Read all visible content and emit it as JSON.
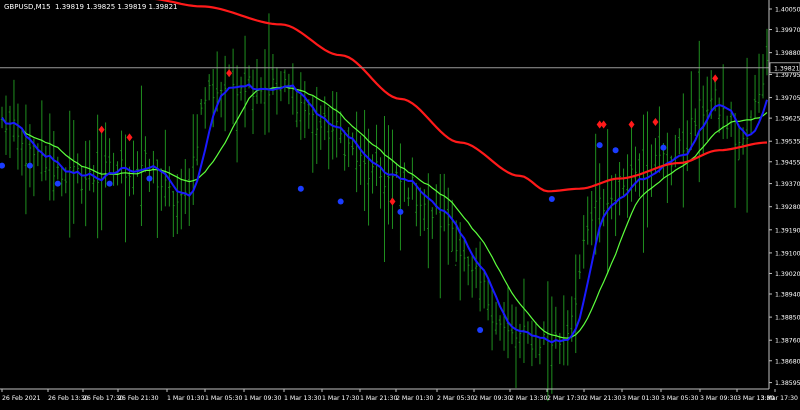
{
  "header": {
    "symbol": "GBPUSD,M15",
    "ohlc": "1.39819 1.39825 1.39819 1.39821"
  },
  "colors": {
    "background": "#000000",
    "axis": "#c0c0c0",
    "text": "#ffffff",
    "candles": "#1f8f1f",
    "ma_fast": "#5cff3c",
    "ma_mid": "#1a1aff",
    "ma_slow": "#ff1a1a",
    "buy_marker": "#1a3cff",
    "sell_marker": "#ff1a1a",
    "bid_line": "#9a9a9a"
  },
  "chart_data": {
    "type": "line",
    "symbol": "GBPUSD",
    "timeframe": "M15",
    "ylim": [
      1.3857,
      1.40085
    ],
    "y_ticks": [
      "1.40050",
      "1.39970",
      "1.39880",
      "1.39795",
      "1.39705",
      "1.39625",
      "1.39535",
      "1.39455",
      "1.39370",
      "1.39280",
      "1.39190",
      "1.39100",
      "1.39020",
      "1.38940",
      "1.38850",
      "1.38760",
      "1.38680",
      "1.38595"
    ],
    "x_ticks": [
      "26 Feb 2021",
      "26 Feb 13:30",
      "26 Feb 17:30",
      "26 Feb 21:30",
      "1 Mar 01:30",
      "1 Mar 05:30",
      "1 Mar 09:30",
      "1 Mar 13:30",
      "1 Mar 17:30",
      "1 Mar 21:30",
      "2 Mar 01:30",
      "2 Mar 05:30",
      "2 Mar 09:30",
      "2 Mar 13:30",
      "2 Mar 17:30",
      "2 Mar 21:30",
      "3 Mar 01:30",
      "3 Mar 05:30",
      "3 Mar 09:30",
      "3 Mar 13:30",
      "3 Mar 17:30"
    ],
    "current_price": "1.39821",
    "bar_count": 193,
    "close_anchors": [
      [
        0,
        1.3961
      ],
      [
        8,
        1.3946
      ],
      [
        20,
        1.3939
      ],
      [
        35,
        1.3944
      ],
      [
        45,
        1.3929
      ],
      [
        52,
        1.3973
      ],
      [
        60,
        1.3977
      ],
      [
        70,
        1.3974
      ],
      [
        82,
        1.3958
      ],
      [
        94,
        1.394
      ],
      [
        100,
        1.3937
      ],
      [
        112,
        1.3922
      ],
      [
        118,
        1.39
      ],
      [
        128,
        1.3877
      ],
      [
        140,
        1.3876
      ],
      [
        150,
        1.3928
      ],
      [
        160,
        1.3943
      ],
      [
        168,
        1.3947
      ],
      [
        178,
        1.3969
      ],
      [
        186,
        1.3952
      ],
      [
        192,
        1.3982
      ]
    ],
    "ma_slow": [
      [
        37,
        1.4009
      ],
      [
        50,
        1.4006
      ],
      [
        70,
        1.3999
      ],
      [
        85,
        1.3987
      ],
      [
        100,
        1.397
      ],
      [
        115,
        1.3953
      ],
      [
        130,
        1.394
      ],
      [
        137,
        1.3934
      ],
      [
        145,
        1.3935
      ],
      [
        155,
        1.3939
      ],
      [
        170,
        1.3945
      ],
      [
        180,
        1.395
      ],
      [
        192,
        1.3953
      ]
    ],
    "ma_fast_period": 15,
    "ma_mid_period": 6,
    "buy_markers": [
      [
        0,
        1.3944
      ],
      [
        7,
        1.3944
      ],
      [
        14,
        1.3937
      ],
      [
        27,
        1.3937
      ],
      [
        37,
        1.3939
      ],
      [
        75,
        1.3935
      ],
      [
        85,
        1.393
      ],
      [
        100,
        1.3926
      ],
      [
        120,
        1.388
      ],
      [
        138,
        1.3931
      ],
      [
        150,
        1.3952
      ],
      [
        154,
        1.395
      ],
      [
        166,
        1.3951
      ]
    ],
    "sell_markers": [
      [
        25,
        1.3958
      ],
      [
        32,
        1.3955
      ],
      [
        57,
        1.398
      ],
      [
        98,
        1.393
      ],
      [
        150,
        1.396
      ],
      [
        151,
        1.396
      ],
      [
        158,
        1.396
      ],
      [
        164,
        1.3961
      ],
      [
        179,
        1.3978
      ]
    ]
  }
}
